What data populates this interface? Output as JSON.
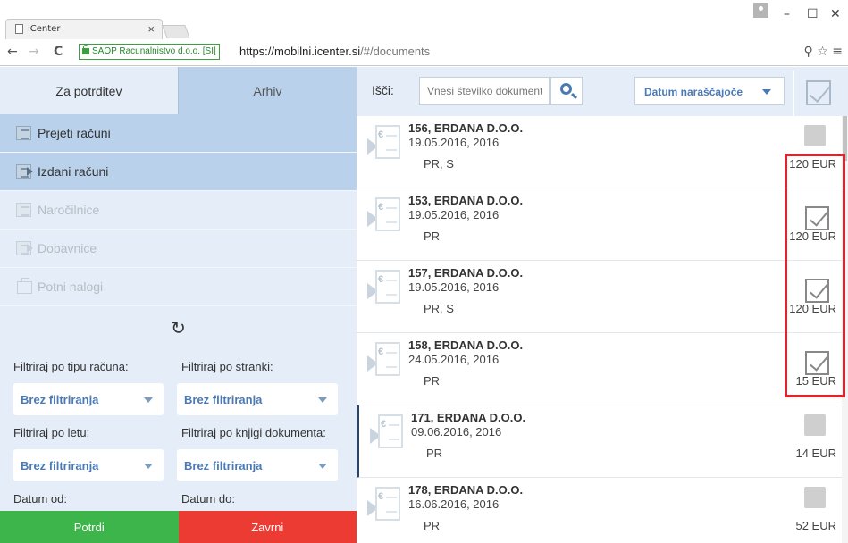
{
  "browser": {
    "tab_title": "iCenter",
    "tab_close": "×",
    "secure_label": "SAOP Racunalnistvo d.o.o. [SI]",
    "url_host": "https://mobilni.icenter.si",
    "url_path": "/#/documents"
  },
  "left": {
    "tabs": {
      "active": "Za potrditev",
      "inactive": "Arhiv"
    },
    "menu": [
      {
        "label": "Prejeti računi",
        "state": "selected"
      },
      {
        "label": "Izdani računi",
        "state": "selected"
      },
      {
        "label": "Naročilnice",
        "state": "disabled"
      },
      {
        "label": "Dobavnice",
        "state": "disabled"
      },
      {
        "label": "Potni nalogi",
        "state": "disabled"
      }
    ],
    "refresh_icon": "↻",
    "filters": {
      "type_label": "Filtriraj po tipu računa:",
      "type_value": "Brez filtriranja",
      "party_label": "Filtriraj po stranki:",
      "party_value": "Brez filtriranja",
      "year_label": "Filtriraj po letu:",
      "year_value": "Brez filtriranja",
      "book_label": "Filtriraj po knjigi dokumenta:",
      "book_value": "Brez filtriranja",
      "date_from_label": "Datum od:",
      "date_to_label": "Datum do:"
    },
    "actions": {
      "confirm": "Potrdi",
      "reject": "Zavrni",
      "confirm_color": "#3db54a",
      "reject_color": "#ec3b33"
    }
  },
  "right": {
    "search_label": "Išči:",
    "search_placeholder": "Vnesi številko dokumenta",
    "sort_value": "Datum naraščajoče",
    "documents": [
      {
        "title": "156, ERDANA D.O.O.",
        "date": "19.05.2016, 2016",
        "tags": "PR, S",
        "amount": "120 EUR",
        "checked": false
      },
      {
        "title": "153, ERDANA D.O.O.",
        "date": "19.05.2016, 2016",
        "tags": "PR",
        "amount": "120 EUR",
        "checked": true
      },
      {
        "title": "157, ERDANA D.O.O.",
        "date": "19.05.2016, 2016",
        "tags": "PR, S",
        "amount": "120 EUR",
        "checked": true
      },
      {
        "title": "158, ERDANA D.O.O.",
        "date": "24.05.2016, 2016",
        "tags": "PR",
        "amount": "15 EUR",
        "checked": true
      },
      {
        "title": "171, ERDANA D.O.O.",
        "date": "09.06.2016, 2016",
        "tags": "PR",
        "amount": "14 EUR",
        "checked": false
      },
      {
        "title": "178, ERDANA D.O.O.",
        "date": "16.06.2016, 2016",
        "tags": "PR",
        "amount": "52 EUR",
        "checked": false
      }
    ]
  }
}
